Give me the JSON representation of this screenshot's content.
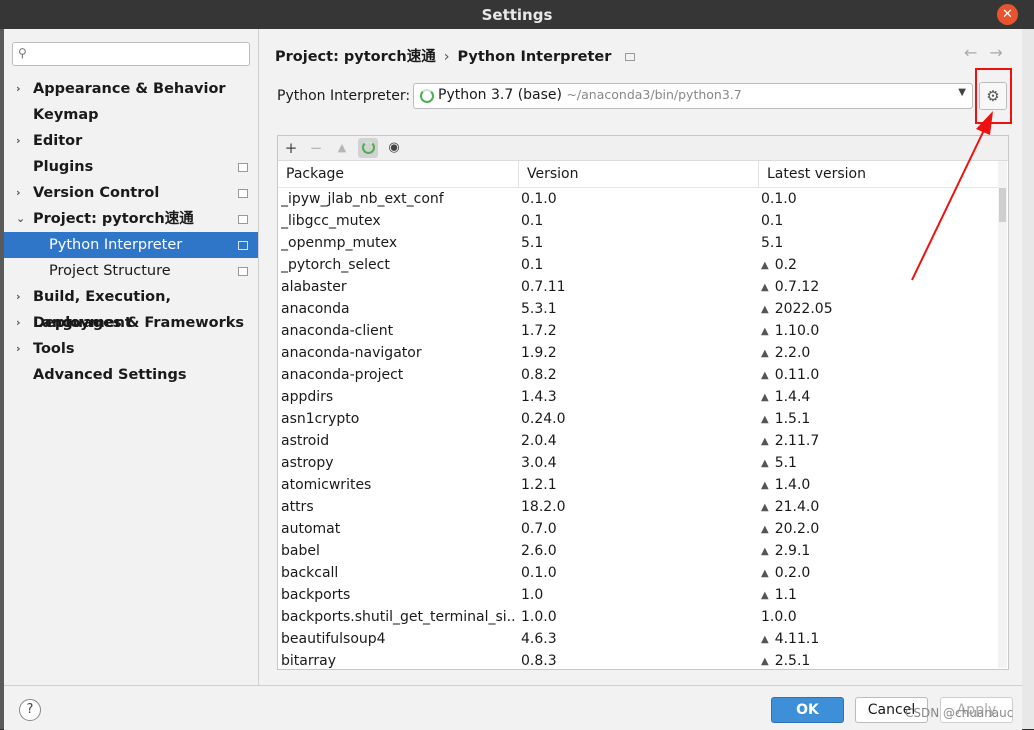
{
  "window": {
    "title": "Settings"
  },
  "search": {
    "placeholder": "",
    "value": ""
  },
  "sidebar": {
    "items": [
      {
        "label": "Appearance & Behavior",
        "arrow": "›"
      },
      {
        "label": "Keymap"
      },
      {
        "label": "Editor",
        "arrow": "›"
      },
      {
        "label": "Plugins"
      },
      {
        "label": "Version Control",
        "arrow": "›"
      },
      {
        "label": "Project: pytorch速通",
        "arrow": "⌄"
      },
      {
        "label": "Python Interpreter"
      },
      {
        "label": "Project Structure"
      },
      {
        "label": "Build, Execution, Deployment",
        "arrow": "›"
      },
      {
        "label": "Languages & Frameworks",
        "arrow": "›"
      },
      {
        "label": "Tools",
        "arrow": "›"
      },
      {
        "label": "Advanced Settings"
      }
    ]
  },
  "breadcrumb": {
    "parent": "Project: pytorch速通",
    "separator": "›",
    "current": "Python Interpreter"
  },
  "nav": {
    "back": "←",
    "forward": "→"
  },
  "interpreter": {
    "label": "Python Interpreter:",
    "name": "Python 3.7 (base)",
    "path": "~/anaconda3/bin/python3.7",
    "gear_icon": "gear-icon"
  },
  "toolbar": {
    "add": "+",
    "remove": "−",
    "upgrade": "▲",
    "eye": "◉"
  },
  "table": {
    "headers": [
      "Package",
      "Version",
      "Latest version"
    ],
    "rows": [
      [
        "_ipyw_jlab_nb_ext_conf",
        "0.1.0",
        "0.1.0",
        false
      ],
      [
        "_libgcc_mutex",
        "0.1",
        "0.1",
        false
      ],
      [
        "_openmp_mutex",
        "5.1",
        "5.1",
        false
      ],
      [
        "_pytorch_select",
        "0.1",
        "0.2",
        true
      ],
      [
        "alabaster",
        "0.7.11",
        "0.7.12",
        true
      ],
      [
        "anaconda",
        "5.3.1",
        "2022.05",
        true
      ],
      [
        "anaconda-client",
        "1.7.2",
        "1.10.0",
        true
      ],
      [
        "anaconda-navigator",
        "1.9.2",
        "2.2.0",
        true
      ],
      [
        "anaconda-project",
        "0.8.2",
        "0.11.0",
        true
      ],
      [
        "appdirs",
        "1.4.3",
        "1.4.4",
        true
      ],
      [
        "asn1crypto",
        "0.24.0",
        "1.5.1",
        true
      ],
      [
        "astroid",
        "2.0.4",
        "2.11.7",
        true
      ],
      [
        "astropy",
        "3.0.4",
        "5.1",
        true
      ],
      [
        "atomicwrites",
        "1.2.1",
        "1.4.0",
        true
      ],
      [
        "attrs",
        "18.2.0",
        "21.4.0",
        true
      ],
      [
        "automat",
        "0.7.0",
        "20.2.0",
        true
      ],
      [
        "babel",
        "2.6.0",
        "2.9.1",
        true
      ],
      [
        "backcall",
        "0.1.0",
        "0.2.0",
        true
      ],
      [
        "backports",
        "1.0",
        "1.1",
        true
      ],
      [
        "backports.shutil_get_terminal_si...",
        "1.0.0",
        "1.0.0",
        false
      ],
      [
        "beautifulsoup4",
        "4.6.3",
        "4.11.1",
        true
      ],
      [
        "bitarray",
        "0.8.3",
        "2.5.1",
        true
      ]
    ]
  },
  "footer": {
    "help": "?",
    "ok": "OK",
    "cancel": "Cancel",
    "apply": "Apply"
  },
  "watermark": "CSDN @chuanauc",
  "colors": {
    "selection": "#2f76c9",
    "ok_button": "#3d8fd8",
    "annotation_red": "#e11111",
    "title_bar": "#363636"
  }
}
